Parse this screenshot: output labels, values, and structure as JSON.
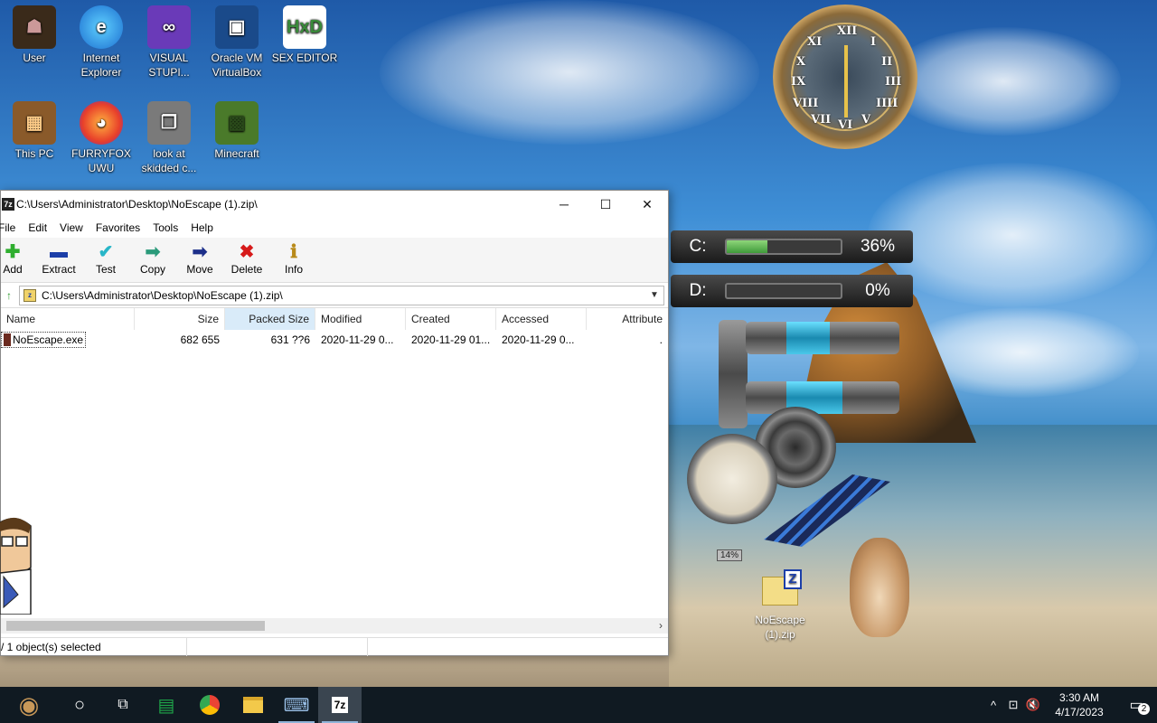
{
  "desktop": {
    "icons": [
      {
        "label": "User"
      },
      {
        "label": "Internet Explorer"
      },
      {
        "label": "VISUAL STUPI..."
      },
      {
        "label": "Oracle VM VirtualBox"
      },
      {
        "label": "SEX EDITOR"
      },
      {
        "label": "This PC"
      },
      {
        "label": "FURRYFOX UWU"
      },
      {
        "label": "look at skidded c..."
      },
      {
        "label": "Minecraft"
      }
    ],
    "zip_icon_label": "NoEscape (1).zip"
  },
  "window": {
    "title": "C:\\Users\\Administrator\\Desktop\\NoEscape (1).zip\\",
    "app_icon_text": "7z",
    "controls": {
      "minimize": "─",
      "maximize": "☐",
      "close": "✕"
    },
    "menu": [
      "File",
      "Edit",
      "View",
      "Favorites",
      "Tools",
      "Help"
    ],
    "toolbar": [
      {
        "label": "Add",
        "icon": "plus-icon",
        "glyph": "✚",
        "color": "#2fae2f"
      },
      {
        "label": "Extract",
        "icon": "minus-icon",
        "glyph": "▬",
        "color": "#1c3fa8"
      },
      {
        "label": "Test",
        "icon": "check-icon",
        "glyph": "✔",
        "color": "#28b6c8"
      },
      {
        "label": "Copy",
        "icon": "arrow-right-icon",
        "glyph": "➡",
        "color": "#2a9a7a"
      },
      {
        "label": "Move",
        "icon": "arrow-right-icon",
        "glyph": "➡",
        "color": "#1c2f8a"
      },
      {
        "label": "Delete",
        "icon": "delete-x-icon",
        "glyph": "✖",
        "color": "#d61a1a"
      },
      {
        "label": "Info",
        "icon": "info-icon",
        "glyph": "ℹ",
        "color": "#b88a1a"
      }
    ],
    "address": "C:\\Users\\Administrator\\Desktop\\NoEscape (1).zip\\",
    "columns": [
      "Name",
      "Size",
      "Packed Size",
      "Modified",
      "Created",
      "Accessed",
      "Attribute"
    ],
    "rows": [
      {
        "name": "NoEscape.exe",
        "size": "682 655",
        "packed": "631 ??6",
        "modified": "2020-11-29 0...",
        "created": "2020-11-29 01...",
        "accessed": "2020-11-29 0...",
        "attr": "."
      }
    ],
    "status": "/ 1 object(s) selected"
  },
  "gadgets": {
    "clock_numbers": [
      "XII",
      "I",
      "II",
      "III",
      "IIII",
      "V",
      "VI",
      "VII",
      "VIII",
      "IX",
      "X",
      "XI"
    ],
    "drives": [
      {
        "label": "C:",
        "percent": "36%",
        "fill": 0.36
      },
      {
        "label": "D:",
        "percent": "0%",
        "fill": 0.0
      }
    ],
    "meter_label": "14%"
  },
  "taskbar": {
    "items": [
      {
        "name": "start-button",
        "icon": "steampunk-orb-icon",
        "glyph": "◉"
      },
      {
        "name": "search-button",
        "icon": "circle-icon",
        "glyph": "○"
      },
      {
        "name": "task-view-button",
        "icon": "task-view-icon",
        "glyph": "⧉"
      },
      {
        "name": "taskbar-app-sheets",
        "icon": "green-app-icon",
        "glyph": "▤"
      },
      {
        "name": "taskbar-app-chrome",
        "icon": "chrome-icon",
        "glyph": "◎"
      },
      {
        "name": "taskbar-app-explorer",
        "icon": "folder-icon",
        "glyph": "▭"
      },
      {
        "name": "taskbar-app-keyboard",
        "icon": "keyboard-icon",
        "glyph": "⌨"
      },
      {
        "name": "taskbar-app-7zip",
        "icon": "7zip-icon",
        "glyph": "7z"
      }
    ],
    "tray": {
      "chevron": "^",
      "network": "⊡",
      "volume": "🔇",
      "time": "3:30 AM",
      "date": "4/17/2023",
      "notification_count": "2"
    }
  }
}
